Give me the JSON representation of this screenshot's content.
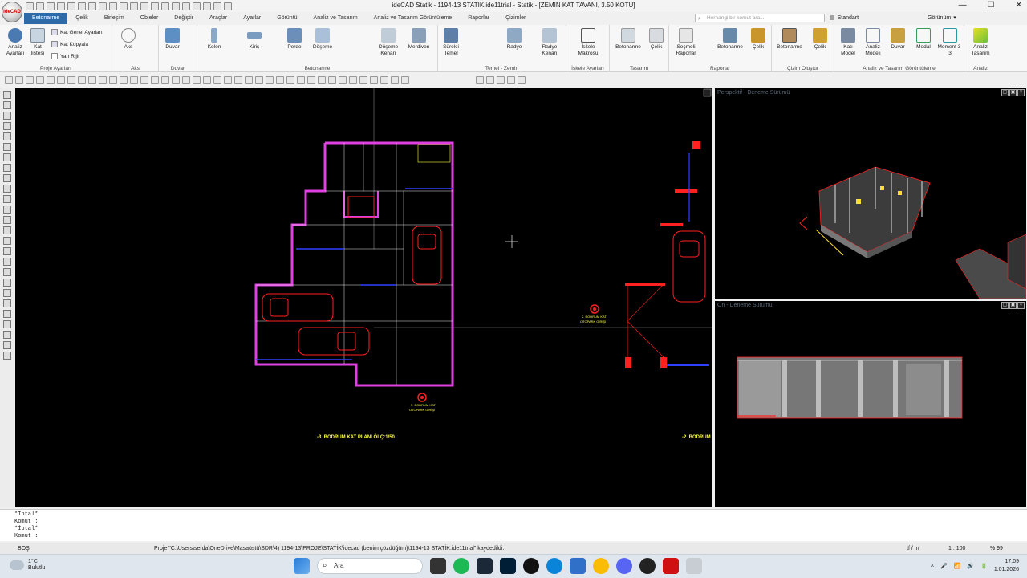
{
  "app": {
    "title": "ideCAD Statik - 1194-13 STATİK.ide11trial - Statik - [ZEMİN KAT TAVANI,  3.50 KOTU]",
    "logo": "ideCAD",
    "window_controls": [
      "—",
      "☐",
      "✕"
    ]
  },
  "menu": {
    "tabs": [
      "Betonarme",
      "Çelik",
      "Birleşim",
      "Objeler",
      "Değiştir",
      "Araçlar",
      "Ayarlar",
      "Görüntü",
      "Analiz ve Tasarım",
      "Analiz ve Tasarım Görüntüleme",
      "Raporlar",
      "Çizimler"
    ],
    "active": "Betonarme",
    "search_placeholder": "Herhangi bir komut ara...",
    "style_value": "Standart",
    "view_label": "Görünüm"
  },
  "ribbon": {
    "groups": [
      {
        "label": "Proje Ayarları"
      },
      {
        "label": "Aks"
      },
      {
        "label": "Duvar"
      },
      {
        "label": "Betonarme"
      },
      {
        "label": "Temel - Zemin"
      },
      {
        "label": "İskele Ayarları"
      },
      {
        "label": "Tasarım"
      },
      {
        "label": "Raporlar"
      },
      {
        "label": "Çizim Oluştur"
      },
      {
        "label": "Analiz ve Tasarım Görüntüleme"
      },
      {
        "label": "Analiz"
      }
    ],
    "buttons": {
      "analiz_ayarlari": "Analiz Ayarları",
      "kat_listesi": "Kat listesi",
      "kat_genel": "Kat Genel Ayarları",
      "kat_kopyala": "Kat Kopyala",
      "yari_rijit": "Yarı Rijit",
      "aks": "Aks",
      "duvar": "Duvar",
      "kolon": "Kolon",
      "kiris": "Kiriş",
      "perde": "Perde",
      "doseme": "Döşeme",
      "doseme_kenari": "Döşeme Kenarı",
      "merdiven": "Merdiven",
      "surekli_temel": "Sürekli Temel",
      "radye": "Radye",
      "radye_kenari": "Radye Kenarı",
      "iskele_makrosu": "İskele Makrosu",
      "tas_betonarme": "Betonarme",
      "tas_celik": "Çelik",
      "secmeli_raporlar": "Seçmeli Raporlar",
      "rap_betonarme": "Betonarme",
      "rap_celik": "Çelik",
      "cz_betonarme": "Betonarme",
      "cz_celik": "Çelik",
      "kati_model": "Katı Model",
      "analiz_modeli": "Analiz Modeli",
      "gor_duvar": "Duvar",
      "modal": "Modal",
      "moment": "Moment 3-3",
      "analiz_tasarim": "Analiz Tasarım"
    }
  },
  "viewports": {
    "perspective_label": "Perspektif - Deneme Sürümü",
    "front_label": "Ön - Deneme Sürümü",
    "plan_title_left": "-3. BODRUM KAT PLANI ÖLÇ:1/50",
    "plan_title_right": "-2. BODRUM",
    "marker_1_line1": "3. BODRUM KAT",
    "marker_1_line2": "OTOPARK GİRİŞİ",
    "marker_2_line1": "2. BODRUM KAT",
    "marker_2_line2": "OTOPARK GİRİŞİ"
  },
  "command": {
    "lines": [
      "*İptal*",
      "Komut :",
      "*İptal*",
      "Komut :"
    ]
  },
  "status": {
    "left": "BOŞ",
    "message": "Proje \"C:\\Users\\serda\\OneDrive\\Masaüstü\\SDR\\4) 1194-13\\PROJE\\STATİK\\idecad (benim çözdüğüm)\\1194-13 STATİK.ide11trial\" kaydedildi.",
    "unit": "tf / m",
    "scale": "1 : 100",
    "zoom": "% 99"
  },
  "taskbar": {
    "temp": "1°C",
    "weather": "Bulutlu",
    "search": "Ara",
    "time": "17:09",
    "date": "1.01.2026"
  },
  "colors": {
    "accent": "#2d6aa7",
    "wall": "#e040e0",
    "red": "#ff2020",
    "yellow": "#ffff40",
    "green": "#40ff40",
    "blue": "#3040ff"
  }
}
